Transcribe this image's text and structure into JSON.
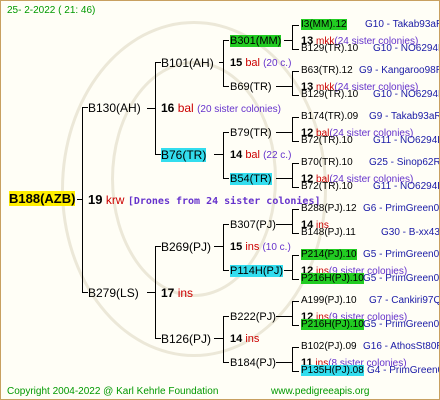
{
  "header": {
    "date": "25-  2-2022 (  21:  46)"
  },
  "footer": {
    "copyright": "Copyright 2004-2022 @ Karl Kehrle Foundation",
    "site": "www.pedigreeapis.org"
  },
  "root": {
    "id": "B188(AZB)",
    "num": "19",
    "code": "krw",
    "note": "[Drones from 24 sister colonies]"
  },
  "gen1": [
    {
      "id": "B130(AH)",
      "num": "16",
      "code": "bal",
      "note": "(20 sister colonies)"
    },
    {
      "id": "B279(LS)",
      "num": "17",
      "code": "ins"
    }
  ],
  "gen2": [
    {
      "id": "B101(AH)",
      "num": "15",
      "code": "bal",
      "note": "(20 c.)"
    },
    {
      "id": "B76(TR)",
      "num": "14",
      "code": "bal",
      "note": "(22 c.)"
    },
    {
      "id": "B269(PJ)",
      "num": "15",
      "code": "ins",
      "note": "(10 c.)"
    },
    {
      "id": "B126(PJ)",
      "num": "14",
      "code": "ins"
    }
  ],
  "gen3": [
    {
      "id": "B301(MM)",
      "num": "13",
      "code": "mkk",
      "note": "(24 sister colonies)"
    },
    {
      "id": "B69(TR)",
      "num": "13",
      "code": "mkk",
      "note": "(24 sister colonies)"
    },
    {
      "id": "B79(TR)",
      "num": "12",
      "code": "bal",
      "note": "(24 sister colonies)"
    },
    {
      "id": "B54(TR)",
      "num": "12",
      "code": "bal",
      "note": "(24 sister colonies)"
    },
    {
      "id": "B307(PJ)",
      "num": "14",
      "code": "ins"
    },
    {
      "id": "P114H(PJ)",
      "num": "12",
      "code": "ins",
      "note": "(9 sister colonies)"
    },
    {
      "id": "B222(PJ)",
      "num": "12",
      "code": "ins",
      "note": "(9 sister colonies)"
    },
    {
      "id": "B184(PJ)",
      "num": "11",
      "code": "ins",
      "note": "(8 sister colonies)"
    }
  ],
  "gen4": [
    {
      "id": "I3(MM).12",
      "src": "G10 - Takab93aR"
    },
    {
      "id": "B129(TR).10",
      "src": "G10 - NO6294R"
    },
    {
      "id": "B63(TR).12",
      "src": "G9 - Kangaroo98R"
    },
    {
      "id": "B129(TR).10",
      "src": "G10 - NO6294R"
    },
    {
      "id": "B174(TR).09",
      "src": "G9 - Takab93aR"
    },
    {
      "id": "B72(TR).10",
      "src": "G11 - NO6294R"
    },
    {
      "id": "B70(TR).10",
      "src": "G25 - Sinop62R"
    },
    {
      "id": "B72(TR).10",
      "src": "G11 - NO6294R"
    },
    {
      "id": "B288(PJ).12",
      "src": "G6 - PrimGreen00"
    },
    {
      "id": "B148(PJ).11",
      "src": "G30 - B-xx43"
    },
    {
      "id": "P214(PJ).10",
      "src": "G5 - PrimGreen00"
    },
    {
      "id": "P216H(PJ).10",
      "src": "G5 - PrimGreen00"
    },
    {
      "id": "A199(PJ).10",
      "src": "G7 - Cankiri97Q"
    },
    {
      "id": "P216H(PJ).10",
      "src": "G5 - PrimGreen00"
    },
    {
      "id": "B102(PJ).09",
      "src": "G16 - AthosSt80R"
    },
    {
      "id": "P135H(PJ).08",
      "src": "G4 - PrimGreen00"
    }
  ],
  "colors": {
    "green_highlight": "#22cc22",
    "cyan_highlight": "#33ddee",
    "yellow_highlight": "#ffee00",
    "red_code": "#cc0000",
    "blue_source": "#1a1aa6",
    "purple_note": "#6633cc",
    "green_footer": "#009900"
  }
}
